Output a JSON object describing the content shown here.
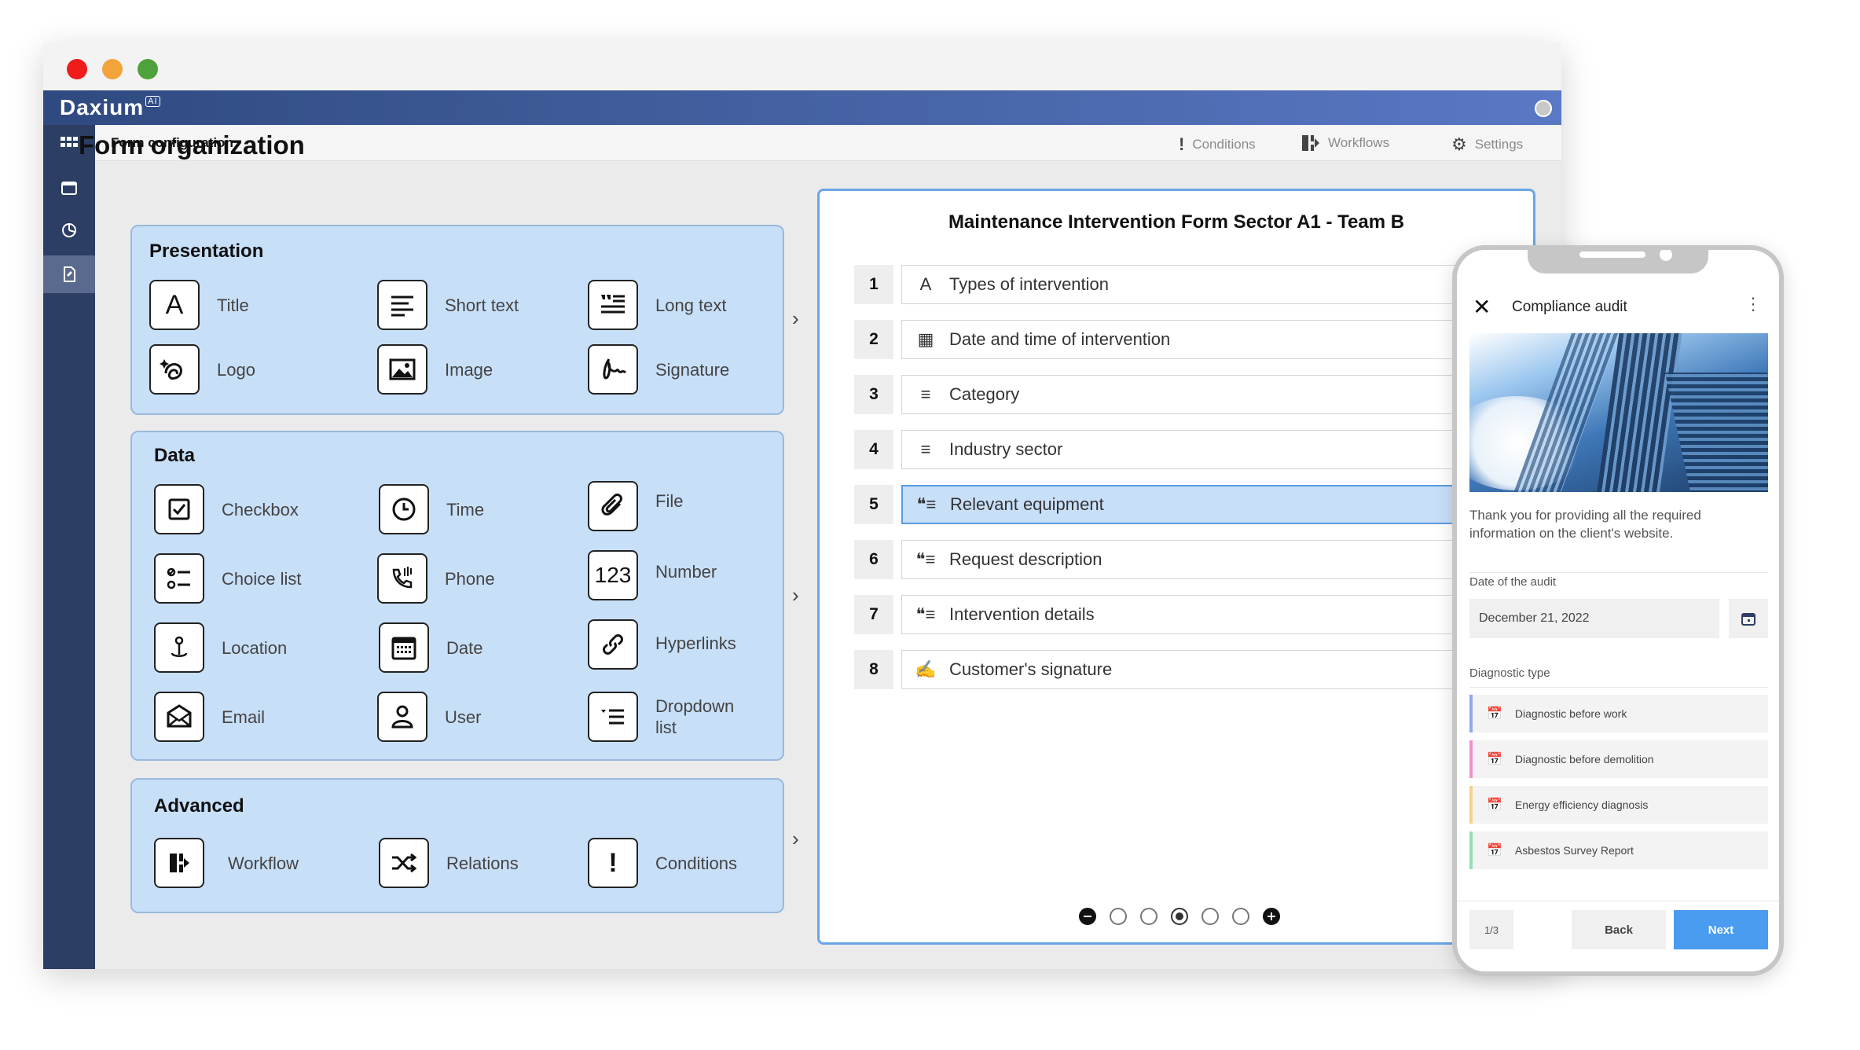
{
  "app": {
    "brand": "Daxium",
    "brand_badge": "AI"
  },
  "toolbar": {
    "title": "Form configuration",
    "conditions_label": "Conditions",
    "workflows_label": "Workflows",
    "settings_label": "Settings"
  },
  "page": {
    "title": "Form organization"
  },
  "palette": {
    "presentation": {
      "title": "Presentation",
      "items": [
        {
          "label": "Title",
          "icon": "letter-a-icon"
        },
        {
          "label": "Short text",
          "icon": "short-text-icon"
        },
        {
          "label": "Long text",
          "icon": "long-text-icon"
        },
        {
          "label": "Logo",
          "icon": "logo-icon"
        },
        {
          "label": "Image",
          "icon": "image-icon"
        },
        {
          "label": "Signature",
          "icon": "signature-icon"
        }
      ]
    },
    "data": {
      "title": "Data",
      "items": [
        {
          "label": "Checkbox",
          "icon": "checkbox-icon"
        },
        {
          "label": "Time",
          "icon": "clock-icon"
        },
        {
          "label": "File",
          "icon": "paperclip-icon"
        },
        {
          "label": "Choice list",
          "icon": "choice-list-icon"
        },
        {
          "label": "Phone",
          "icon": "phone-icon"
        },
        {
          "label": "Number",
          "icon": "number-icon",
          "glyph": "123"
        },
        {
          "label": "Location",
          "icon": "location-pin-icon"
        },
        {
          "label": "Date",
          "icon": "calendar-icon"
        },
        {
          "label": "Hyperlinks",
          "icon": "link-icon"
        },
        {
          "label": "Email",
          "icon": "envelope-icon"
        },
        {
          "label": "User",
          "icon": "user-icon"
        },
        {
          "label": "Dropdown list",
          "icon": "dropdown-list-icon"
        }
      ]
    },
    "advanced": {
      "title": "Advanced",
      "items": [
        {
          "label": "Workflow",
          "icon": "workflow-icon"
        },
        {
          "label": "Relations",
          "icon": "shuffle-icon"
        },
        {
          "label": "Conditions",
          "icon": "exclamation-icon",
          "glyph": "!"
        }
      ]
    }
  },
  "form": {
    "title": "Maintenance Intervention Form Sector A1 - Team B",
    "rows": [
      {
        "num": "1",
        "label": "Types of intervention",
        "icon": "letter-a-icon",
        "glyph": "A"
      },
      {
        "num": "2",
        "label": "Date and time of intervention",
        "icon": "calendar-icon",
        "glyph": "▦"
      },
      {
        "num": "3",
        "label": "Category",
        "icon": "short-text-icon",
        "glyph": "≡"
      },
      {
        "num": "4",
        "label": "Industry sector",
        "icon": "short-text-icon",
        "glyph": "≡"
      },
      {
        "num": "5",
        "label": "Relevant equipment",
        "icon": "long-text-icon",
        "glyph": "❝≡",
        "selected": true
      },
      {
        "num": "6",
        "label": "Request description",
        "icon": "long-text-icon",
        "glyph": "❝≡"
      },
      {
        "num": "7",
        "label": "Intervention details",
        "icon": "long-text-icon",
        "glyph": "❝≡"
      },
      {
        "num": "8",
        "label": "Customer's signature",
        "icon": "signature-icon",
        "glyph": "✍"
      }
    ],
    "pagination_current": 3,
    "pagination_total": 5
  },
  "phone": {
    "title": "Compliance audit",
    "intro": "Thank you for providing all the required information on the client's website.",
    "date_label": "Date of the audit",
    "date_value": "December 21, 2022",
    "diag_label": "Diagnostic type",
    "options": [
      {
        "label": "Diagnostic before work",
        "color": "#8fa9f0"
      },
      {
        "label": "Diagnostic before demolition",
        "color": "#f08fd0"
      },
      {
        "label": "Energy efficiency diagnosis",
        "color": "#f5d28a"
      },
      {
        "label": "Asbestos Survey Report",
        "color": "#8fe0b4"
      }
    ],
    "page_indicator": "1/3",
    "back_label": "Back",
    "next_label": "Next",
    "accent": "#4a9cf0"
  }
}
